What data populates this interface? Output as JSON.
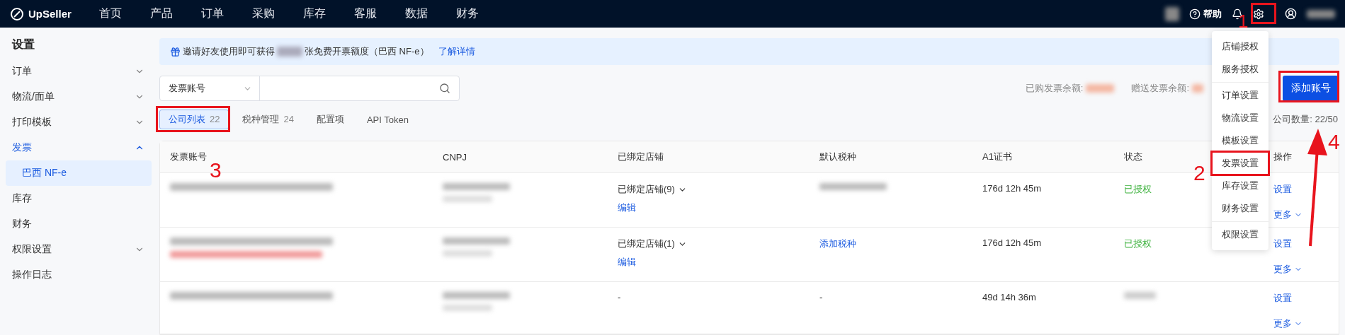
{
  "topbar": {
    "logo": "UpSeller",
    "nav": [
      "首页",
      "产品",
      "订单",
      "采购",
      "库存",
      "客服",
      "数据",
      "财务"
    ],
    "help": "帮助"
  },
  "sidebar": {
    "title": "设置",
    "items": [
      {
        "label": "订单",
        "expanded": false,
        "selected": false
      },
      {
        "label": "物流/面单",
        "expanded": false,
        "selected": false
      },
      {
        "label": "打印模板",
        "expanded": false,
        "selected": false
      },
      {
        "label": "发票",
        "expanded": true,
        "selected": true,
        "children": [
          {
            "label": "巴西 NF-e",
            "selected": true
          }
        ]
      },
      {
        "label": "库存",
        "selected": false
      },
      {
        "label": "财务",
        "selected": false
      },
      {
        "label": "权限设置",
        "expanded": false,
        "selected": false
      },
      {
        "label": "操作日志",
        "selected": false
      }
    ]
  },
  "banner": {
    "text_before": "邀请好友使用即可获得",
    "text_after": "张免费开票额度（巴西 NF-e）",
    "link": "了解详情"
  },
  "search": {
    "field_select": "发票账号"
  },
  "balances": [
    {
      "label": "已购发票余额:"
    },
    {
      "label": "赠送发票余额:"
    }
  ],
  "add_button": "添加账号",
  "tabs": [
    {
      "label": "公司列表",
      "count": "22",
      "selected": true
    },
    {
      "label": "税种管理",
      "count": "24",
      "selected": false
    },
    {
      "label": "配置项",
      "selected": false
    },
    {
      "label": "API Token",
      "selected": false
    }
  ],
  "company_count": {
    "label": "公司数量:",
    "value": "22/50"
  },
  "table": {
    "columns": [
      "发票账号",
      "CNPJ",
      "已绑定店铺",
      "默认税种",
      "A1证书",
      "状态",
      "操作"
    ],
    "rows": [
      {
        "account": {
          "warning": false
        },
        "bound_shops": "已绑定店铺(9)",
        "edit": "编辑",
        "tax": {
          "kind": "blurred"
        },
        "cert": "176d 12h 45m",
        "status": {
          "kind": "authorized",
          "text": "已授权"
        },
        "actions": [
          "设置",
          "更多"
        ]
      },
      {
        "account": {
          "warning": true
        },
        "bound_shops": "已绑定店铺(1)",
        "edit": "编辑",
        "tax": {
          "kind": "link",
          "text": "添加税种"
        },
        "cert": "176d 12h 45m",
        "status": {
          "kind": "authorized",
          "text": "已授权"
        },
        "actions": [
          "设置",
          "更多"
        ]
      },
      {
        "account": {
          "warning": false
        },
        "bound_shops": "-",
        "tax": {
          "kind": "text",
          "text": "-"
        },
        "cert": "49d 14h 36m",
        "status": {
          "kind": "blurred"
        },
        "actions": [
          "设置",
          "更多"
        ]
      }
    ]
  },
  "settings_menu": {
    "groups": [
      [
        {
          "label": "店铺授权",
          "framed": false
        },
        {
          "label": "服务授权",
          "framed": false
        }
      ],
      [
        {
          "label": "订单设置",
          "framed": false
        },
        {
          "label": "物流设置",
          "framed": false
        },
        {
          "label": "模板设置",
          "framed": false
        },
        {
          "label": "发票设置",
          "framed": true
        },
        {
          "label": "库存设置",
          "framed": false
        },
        {
          "label": "财务设置",
          "framed": false
        }
      ],
      [
        {
          "label": "权限设置",
          "framed": false
        }
      ]
    ]
  },
  "annotations": [
    "1",
    "2",
    "3",
    "4"
  ]
}
